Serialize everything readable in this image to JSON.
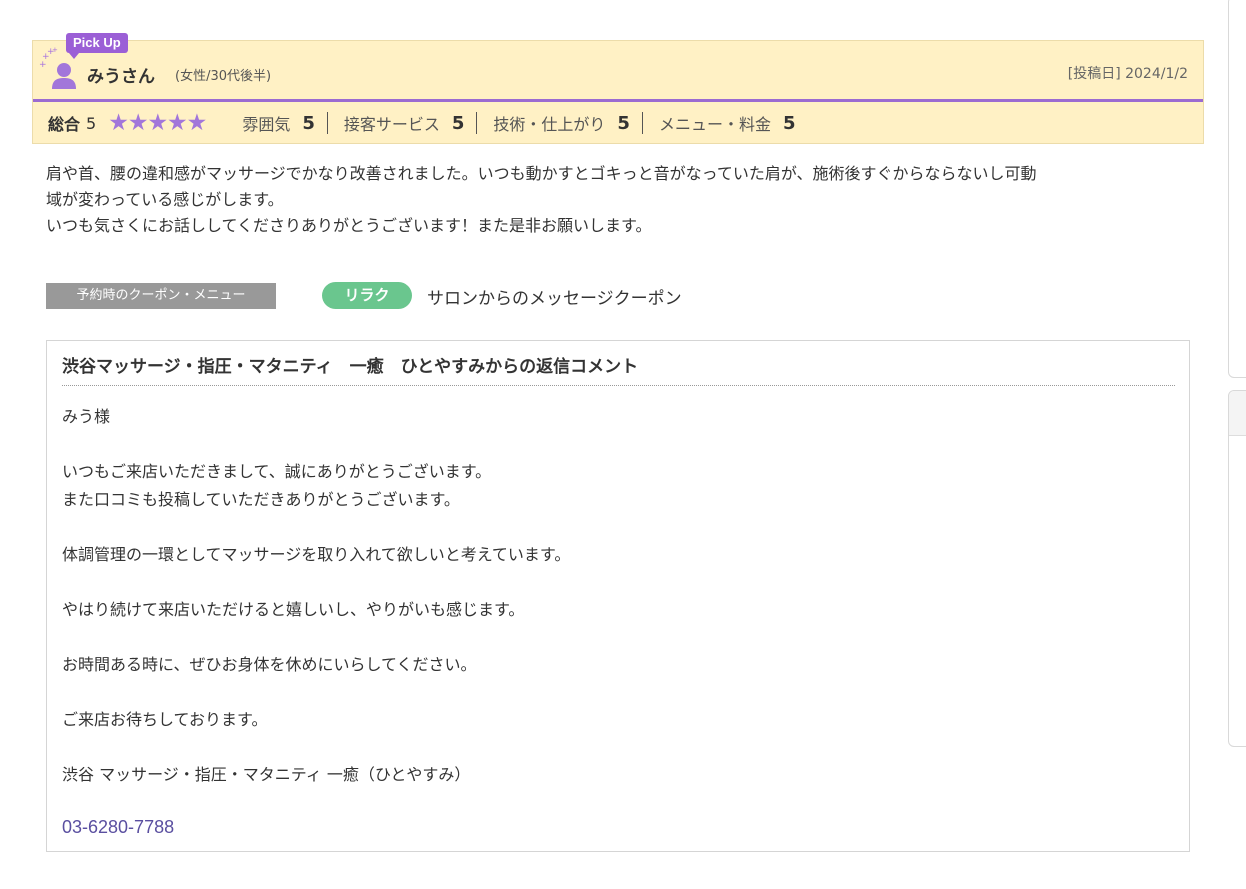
{
  "review": {
    "badge": "Pick Up",
    "reviewer_name": "みうさん",
    "reviewer_meta": "(女性/30代後半)",
    "post_date": "[投稿日] 2024/1/2",
    "overall_label": "総合",
    "overall_value": "5",
    "stars": "★★★★★",
    "star_rating": 5,
    "categories": [
      {
        "label": "雰囲気",
        "value": "5"
      },
      {
        "label": "接客サービス",
        "value": "5"
      },
      {
        "label": "技術・仕上がり",
        "value": "5"
      },
      {
        "label": "メニュー・料金",
        "value": "5"
      }
    ],
    "body": [
      "肩や首、腰の違和感がマッサージでかなり改善されました。いつも動かすとゴキっと音がなっていた肩が、施術後すぐからならないし可動\n域が変わっている感じがします。",
      "いつも気さくにお話ししてくださりありがとうございます！また是非お願いします。"
    ]
  },
  "coupon": {
    "label": "予約時のクーポン・メニュー",
    "badge": "リラク",
    "name": "サロンからのメッセージクーポン"
  },
  "reply": {
    "title": "渋谷マッサージ・指圧・マタニティ　一癒　ひとやすみからの返信コメント",
    "paragraphs": [
      "みう様",
      "いつもご来店いただきまして、誠にありがとうございます。\nまた口コミも投稿していただきありがとうございます。",
      "体調管理の一環としてマッサージを取り入れて欲しいと考えています。",
      "やはり続けて来店いただけると嬉しいし、やりがいも感じます。",
      "お時間ある時に、ぜひお身体を休めにいらしてください。",
      "ご来店お待ちしております。",
      "渋谷 マッサージ・指圧・マタニティ 一癒（ひとやすみ）"
    ],
    "phone": "03-6280-7788"
  },
  "colors": {
    "header_bg": "#fff1c5",
    "accent_purple": "#9b6bd1",
    "star_color": "#a276da",
    "relax_green": "#6ac68e",
    "phone_link": "#5a4fa0"
  },
  "icons": {
    "avatar": "user-avatar-icon",
    "sparkle": "sparkle-icon",
    "star": "star-icon"
  }
}
